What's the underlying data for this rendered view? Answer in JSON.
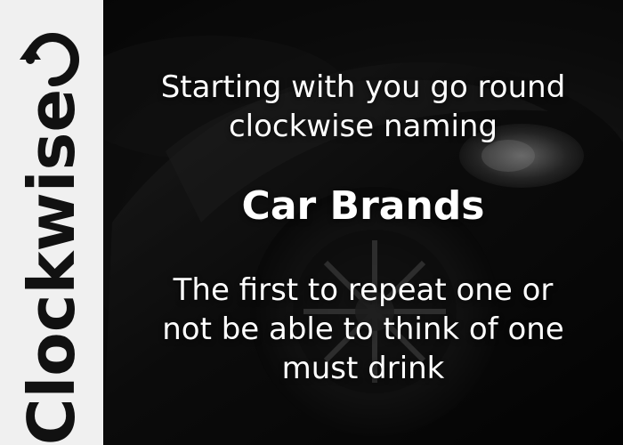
{
  "sidebar": {
    "label": "Clockwise",
    "icon": "clockwise-arrow-icon",
    "background": "#f0f0f0",
    "text_color": "#111111"
  },
  "content": {
    "intro_line1": "Starting with you go round",
    "intro_line2": "clockwise naming",
    "topic": "Car Brands",
    "rule_line1": "The first to repeat one or",
    "rule_line2": "not be able to think of one",
    "rule_line3": "must drink",
    "text_color": "#ffffff"
  },
  "background": {
    "image": "car-photo-dark"
  }
}
